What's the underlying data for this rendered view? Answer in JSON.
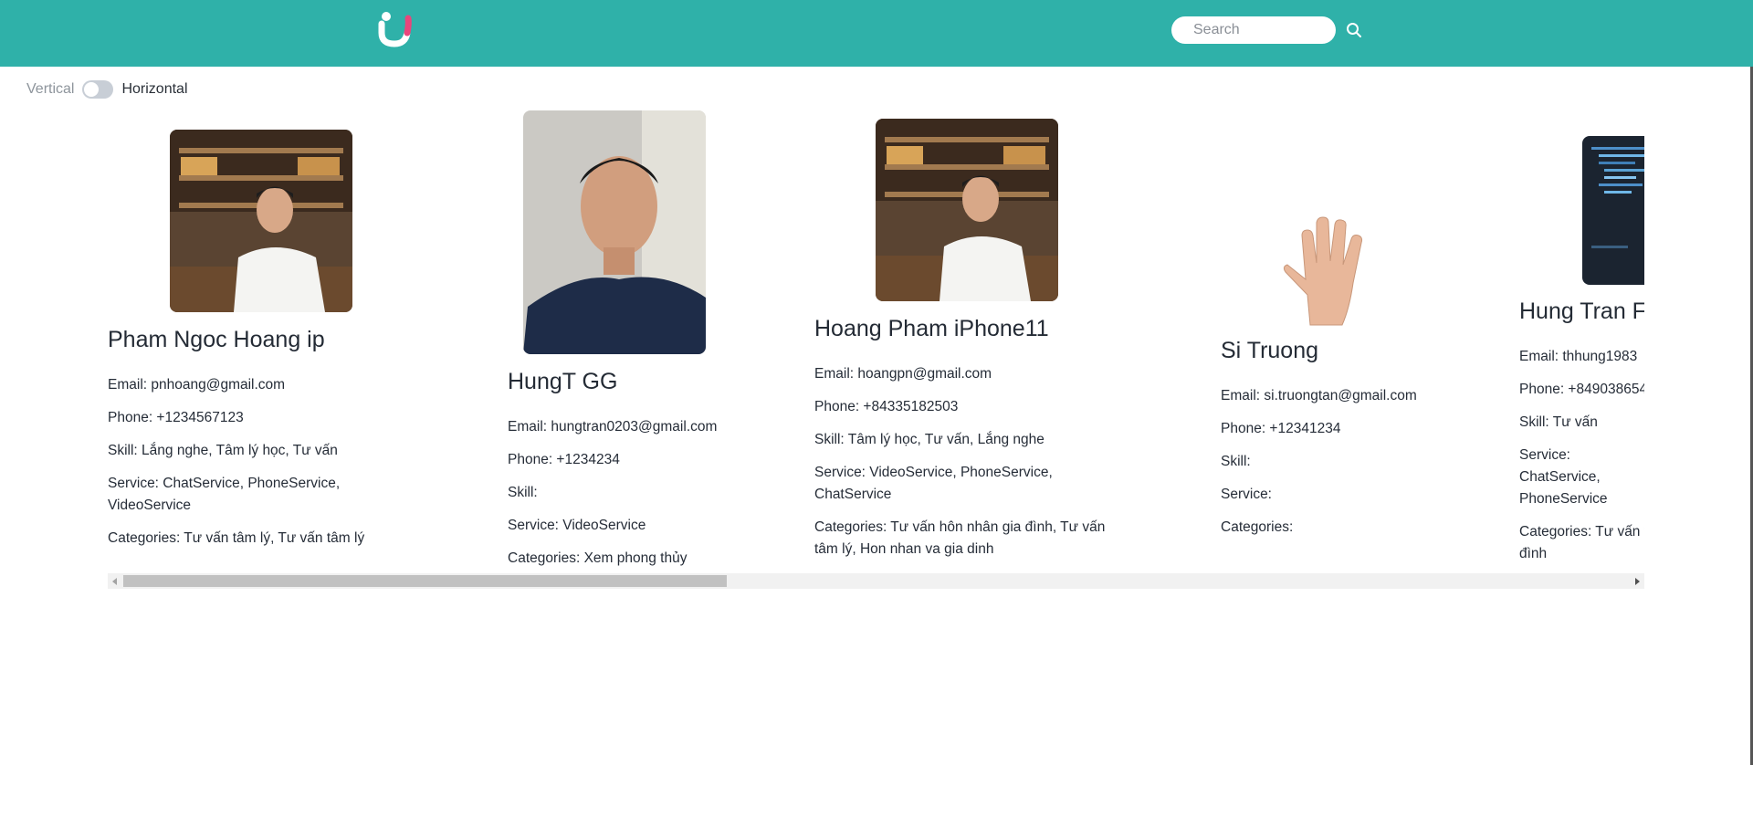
{
  "header": {
    "logo_icon": "brand-u-logo-icon",
    "search_placeholder": "Search",
    "search_icon": "search-icon",
    "bg_color": "#2fb1a9"
  },
  "layout_toggle": {
    "left_label": "Vertical",
    "right_label": "Horizontal",
    "state": "Vertical"
  },
  "experts": [
    {
      "name": "Pham Ngoc Hoang ip",
      "email": "Email: pnhoang@gmail.com",
      "phone": "Phone: +1234567123",
      "skill": "Skill: Lắng nghe, Tâm lý học, Tư vấn",
      "service": "Service: ChatService, PhoneService, VideoService",
      "categories": "Categories: Tư vấn tâm lý, Tư vấn tâm lý",
      "photo_icon": "man-portrait-bar-photo"
    },
    {
      "name": "HungT GG",
      "email": "Email: hungtran0203@gmail.com",
      "phone": "Phone: +1234234",
      "skill": "Skill:",
      "service": "Service: VideoService",
      "categories": "Categories: Xem phong thủy",
      "photo_icon": "man-selfie-photo"
    },
    {
      "name": "Hoang Pham iPhone11",
      "email": "Email: hoangpn@gmail.com",
      "phone": "Phone: +84335182503",
      "skill": "Skill: Tâm lý học, Tư vấn, Lắng nghe",
      "service": "Service: VideoService, PhoneService, ChatService",
      "categories": "Categories: Tư vấn hôn nhân gia đình, Tư vấn tâm lý, Hon nhan va gia dinh",
      "photo_icon": "man-portrait-bar-photo"
    },
    {
      "name": "Si Truong",
      "email": "Email: si.truongtan@gmail.com",
      "phone": "Phone: +12341234",
      "skill": "Skill:",
      "service": "Service:",
      "categories": "Categories:",
      "photo_icon": "raised-hand-photo"
    },
    {
      "name": "Hung Tran Fl",
      "email": "Email: thhung1983",
      "phone": "Phone: +849038654",
      "skill": "Skill: Tư vấn",
      "service": "Service: ChatService, PhoneService",
      "categories": "Categories: Tư vấn t đình",
      "photo_icon": "code-screen-photo"
    }
  ],
  "horizontal_scrollbar": {
    "position_fraction": 0.0,
    "visible_fraction": 0.39
  }
}
